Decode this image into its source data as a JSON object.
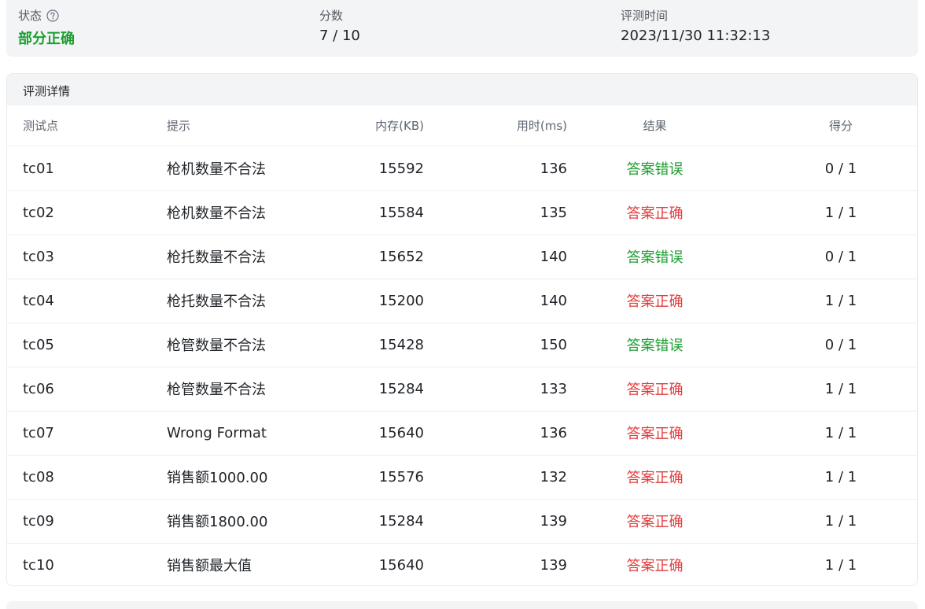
{
  "summary": {
    "status_label": "状态",
    "status_value": "部分正确",
    "score_label": "分数",
    "score_value": "7 / 10",
    "time_label": "评测时间",
    "time_value": "2023/11/30 11:32:13"
  },
  "details": {
    "title": "评测详情",
    "columns": {
      "id": "测试点",
      "hint": "提示",
      "memory": "内存(KB)",
      "time": "用时(ms)",
      "result": "结果",
      "score": "得分"
    },
    "rows": [
      {
        "id": "tc01",
        "hint": "枪机数量不合法",
        "memory": "15592",
        "time": "136",
        "result": "答案错误",
        "score": "0 / 1"
      },
      {
        "id": "tc02",
        "hint": "枪机数量不合法",
        "memory": "15584",
        "time": "135",
        "result": "答案正确",
        "score": "1 / 1"
      },
      {
        "id": "tc03",
        "hint": "枪托数量不合法",
        "memory": "15652",
        "time": "140",
        "result": "答案错误",
        "score": "0 / 1"
      },
      {
        "id": "tc04",
        "hint": "枪托数量不合法",
        "memory": "15200",
        "time": "140",
        "result": "答案正确",
        "score": "1 / 1"
      },
      {
        "id": "tc05",
        "hint": "枪管数量不合法",
        "memory": "15428",
        "time": "150",
        "result": "答案错误",
        "score": "0 / 1"
      },
      {
        "id": "tc06",
        "hint": "枪管数量不合法",
        "memory": "15284",
        "time": "133",
        "result": "答案正确",
        "score": "1 / 1"
      },
      {
        "id": "tc07",
        "hint": "Wrong Format",
        "memory": "15640",
        "time": "136",
        "result": "答案正确",
        "score": "1 / 1"
      },
      {
        "id": "tc08",
        "hint": "销售额1000.00",
        "memory": "15576",
        "time": "132",
        "result": "答案正确",
        "score": "1 / 1"
      },
      {
        "id": "tc09",
        "hint": "销售额1800.00",
        "memory": "15284",
        "time": "139",
        "result": "答案正确",
        "score": "1 / 1"
      },
      {
        "id": "tc10",
        "hint": "销售额最大值",
        "memory": "15640",
        "time": "139",
        "result": "答案正确",
        "score": "1 / 1"
      }
    ]
  },
  "colors": {
    "green": "#1a9e2e",
    "red": "#e03c3c"
  },
  "icons": {
    "status_help": "question-circle-icon"
  }
}
